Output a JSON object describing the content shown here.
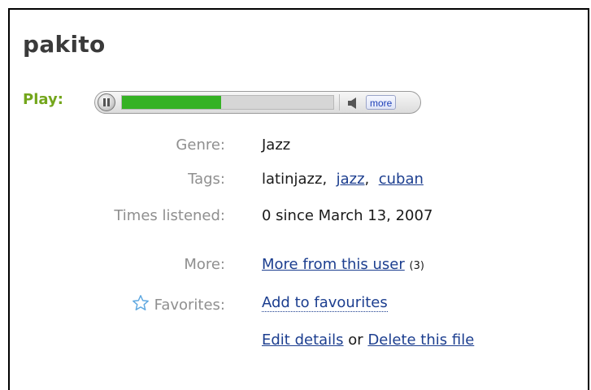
{
  "title": "pakito",
  "player": {
    "play_label": "Play:",
    "progress": 0.47,
    "more_label": "more",
    "icons": {
      "pause": "pause-icon",
      "speaker": "speaker-icon"
    },
    "colors": {
      "fill": "#35b224",
      "track": "#d6d6d6"
    }
  },
  "details": {
    "genre_label": "Genre:",
    "genre_value": "Jazz",
    "tags_label": "Tags:",
    "tags": [
      {
        "text": "latinjazz",
        "link": false
      },
      {
        "text": "jazz",
        "link": true
      },
      {
        "text": "cuban",
        "link": true
      }
    ],
    "times_label": "Times listened:",
    "times_value": "0 since March 13, 2007",
    "more_label": "More:",
    "more_link": "More from this user",
    "more_count": "(3)",
    "favorites_label": "Favorites:",
    "favorites_link": "Add to favourites",
    "edit_link": "Edit details",
    "or_text": "or",
    "delete_link": "Delete this file"
  },
  "colors": {
    "play_label": "#73a61b",
    "link": "#1c3e8f",
    "label": "#8f8f8f",
    "star": "#5fa8e0"
  }
}
